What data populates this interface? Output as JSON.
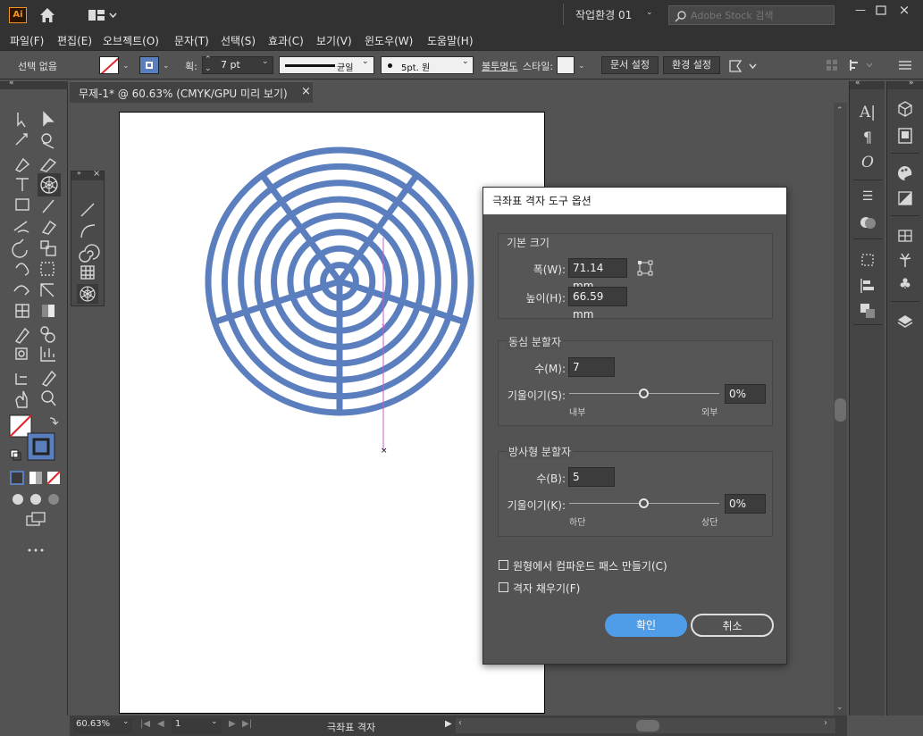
{
  "app": {
    "logo": "Ai"
  },
  "titlebar": {
    "workspace": "작업환경 01",
    "search_placeholder": "Adobe Stock 검색"
  },
  "menu": [
    "파일(F)",
    "편집(E)",
    "오브젝트(O)",
    "문자(T)",
    "선택(S)",
    "효과(C)",
    "보기(V)",
    "윈도우(W)",
    "도움말(H)"
  ],
  "control": {
    "selection": "선택 없음",
    "stroke_label": "획:",
    "stroke_value": "7 pt",
    "profile": "균일",
    "brush": "5pt. 원",
    "opacity_label": "불투명도",
    "style_label": "스타일:",
    "doc_setup": "문서 설정",
    "prefs": "환경 설정"
  },
  "document": {
    "tab_title": "무제-1* @ 60.63% (CMYK/GPU 미리 보기)",
    "close": "×"
  },
  "status": {
    "zoom": "60.63%",
    "page": "1",
    "tool_name": "극좌표 격자"
  },
  "dialog": {
    "title": "극좌표 격자 도구 옵션",
    "size_group": "기본 크기",
    "width_label": "폭(W):",
    "width_value": "71.14 mm",
    "height_label": "높이(H):",
    "height_value": "66.59 mm",
    "concentric_group": "동심 분할자",
    "concentric_count_label": "수(M):",
    "concentric_count": "7",
    "concentric_skew_label": "기울이기(S):",
    "concentric_skew": "0%",
    "concentric_left": "내부",
    "concentric_right": "외부",
    "concentric_skew_fraction": 0.5,
    "radial_group": "방사형 분할자",
    "radial_count_label": "수(B):",
    "radial_count": "5",
    "radial_skew_label": "기울이기(K):",
    "radial_skew": "0%",
    "radial_left": "하단",
    "radial_right": "상단",
    "radial_skew_fraction": 0.5,
    "compound_label": "원형에서 컴파운드 패스 만들기(C)",
    "fill_label": "격자 채우기(F)",
    "ok": "확인",
    "cancel": "취소"
  },
  "colors": {
    "grid_stroke": "#5b7fbe",
    "ok_button": "#4f9de8",
    "guide": "#c85ad0"
  }
}
